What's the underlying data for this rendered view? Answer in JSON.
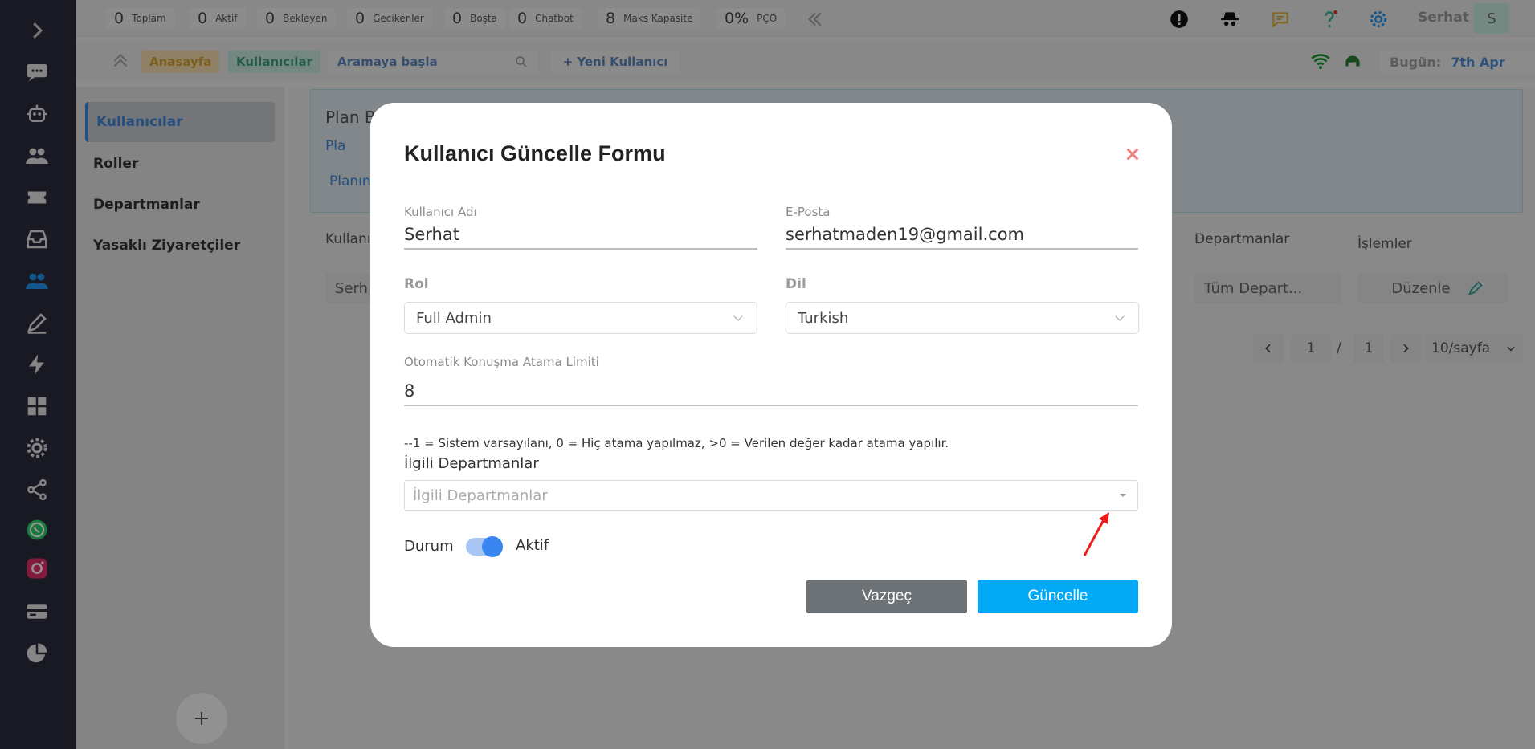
{
  "topbar": {
    "stats": [
      {
        "value": "0",
        "label": "Toplam"
      },
      {
        "value": "0",
        "label": "Aktif"
      },
      {
        "value": "0",
        "label": "Bekleyen"
      },
      {
        "value": "0",
        "label": "Gecikenler"
      },
      {
        "value": "0",
        "label": "Boşta"
      },
      {
        "value": "0",
        "label": "Chatbot"
      },
      {
        "value": "8",
        "label": "Maks Kapasite"
      },
      {
        "value": "0%",
        "label": "PÇO"
      }
    ],
    "user_name": "Serhat",
    "avatar_initial": "S"
  },
  "breadcrumb": {
    "home": "Anasayfa",
    "users": "Kullanıcılar",
    "search_placeholder": "Aramaya başla",
    "new_user": "+ Yeni Kullanıcı",
    "today_label": "Bugün:",
    "today_value": "7th Apr"
  },
  "submenu": {
    "items": [
      "Kullanıcılar",
      "Roller",
      "Departmanlar",
      "Yasaklı Ziyaretçiler"
    ]
  },
  "background": {
    "plan_title": "Plan B",
    "plan_link": "Pla",
    "plan_more": "Planın",
    "col_user": "Kullanıc",
    "col_departments": "Departmanlar",
    "col_actions": "İşlemler",
    "row_user": "Serh",
    "row_departments": "Tüm Depart...",
    "row_edit": "Düzenle",
    "pager_current": "1",
    "pager_separator": "/",
    "pager_total": "1",
    "pager_size": "10/sayfa"
  },
  "modal": {
    "title": "Kullanıcı Güncelle Formu",
    "username_label": "Kullanıcı Adı",
    "username_value": "Serhat",
    "email_label": "E-Posta",
    "email_value": "serhatmaden19@gmail.com",
    "role_label": "Rol",
    "role_value": "Full Admin",
    "language_label": "Dil",
    "language_value": "Turkish",
    "limit_label": "Otomatik Konuşma Atama Limiti",
    "limit_value": "8",
    "hint": "--1 = Sistem varsayılanı, 0 = Hiç atama yapılmaz, >0 = Verilen değer kadar atama yapılır.",
    "departments_label": "İlgili Departmanlar",
    "departments_placeholder": "İlgili Departmanlar",
    "status_label": "Durum",
    "status_value": "Aktif",
    "cancel_label": "Vazgeç",
    "update_label": "Güncelle"
  },
  "colors": {
    "rail": "#2b2b3d",
    "accent_blue": "#03a9f4",
    "home_chip": "#f5deb0",
    "users_chip": "#c9e8dd"
  }
}
